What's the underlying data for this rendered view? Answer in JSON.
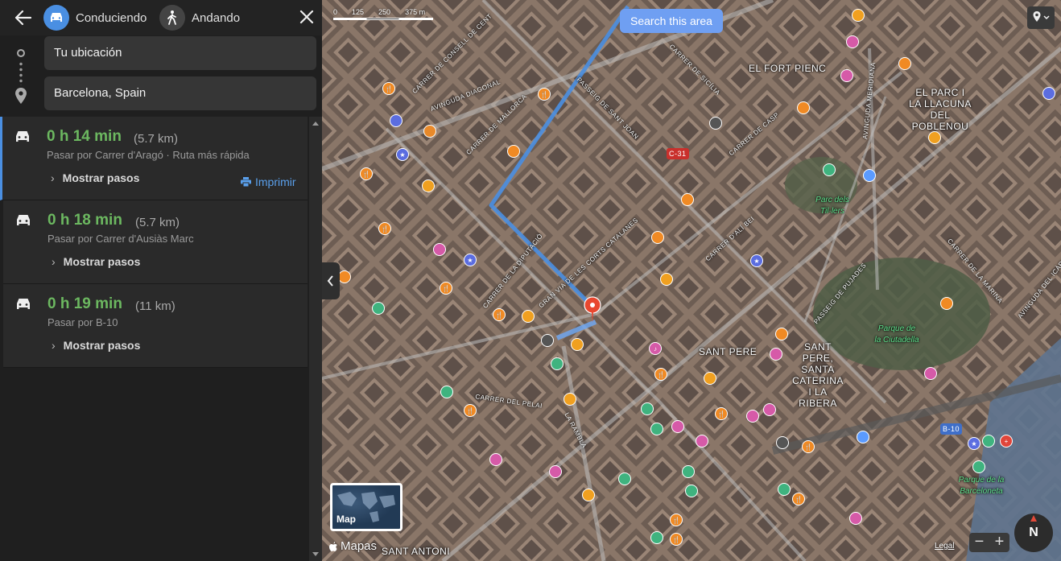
{
  "header": {
    "modes": [
      {
        "label": "Conduciendo",
        "icon": "car-icon",
        "active": true
      },
      {
        "label": "Andando",
        "icon": "walk-icon",
        "active": false
      }
    ]
  },
  "waypoints": {
    "from": "Tu ubicación",
    "to": "Barcelona, Spain"
  },
  "routes": [
    {
      "time": "0 h 14 min",
      "distance": "(5.7 km)",
      "via": "Pasar por Carrer d'Aragó · Ruta más rápida",
      "steps_label": "Mostrar pasos",
      "print_label": "Imprimir"
    },
    {
      "time": "0 h 18 min",
      "distance": "(5.7 km)",
      "via": "Pasar por Carrer d'Ausiàs Marc",
      "steps_label": "Mostrar pasos"
    },
    {
      "time": "0 h 19 min",
      "distance": "(11 km)",
      "via": "Pasar por B-10",
      "steps_label": "Mostrar pasos"
    }
  ],
  "map": {
    "search_area_label": "Search this area",
    "scale_ticks": [
      "0",
      "125",
      "250",
      "375 m"
    ],
    "minimap_label": "Map",
    "brand": "Mapas",
    "legal": "Legal",
    "compass": "N",
    "zoom_out": "−",
    "zoom_in": "+",
    "districts": [
      "EL FORT PIENC",
      "EL PARC I LA LLACUNA DEL POBLENOU",
      "SANT PERE",
      "SANT PERE, SANTA CATERINA I LA RIBERA",
      "SANT ANTONI"
    ],
    "parks": [
      "Parc dels Til·lers",
      "Parque de la Ciutadella",
      "Parque de la Barceloneta"
    ],
    "streets": [
      "CARRER DE CONSELL DE CENT",
      "AVINGUDA DIAGONAL",
      "CARRER DE MALLORCA",
      "PASSEIG DE SANT JOAN",
      "CARRER DE LA DIPUTACIÓ",
      "GRAN VIA DE LES CORTS CATALANES",
      "CARRER DEL PELAI",
      "LA RAMBLA",
      "PASSEIG DE PUJADES",
      "AVINGUDA MERIDIANA",
      "CARRER DE LA MARINA",
      "AVINGUDA DEL ICÀRIA",
      "CARRER D'ALÍ BEI",
      "CARRER DE SICÍLIA",
      "CARRER DE CASP"
    ],
    "road_badges": [
      "C-31",
      "B-10"
    ],
    "colors": {
      "route": "#4a8fe2",
      "time": "#6cb860",
      "accent": "#5aa0ec"
    }
  }
}
